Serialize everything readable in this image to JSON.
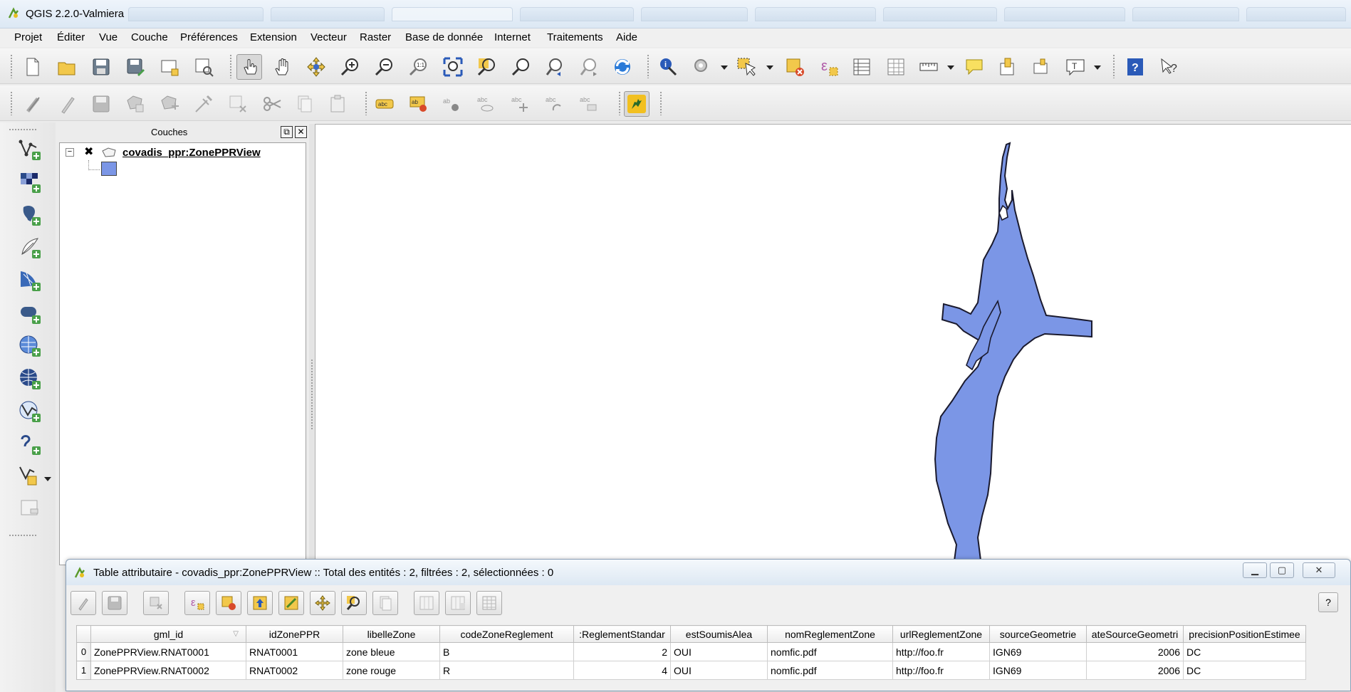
{
  "window": {
    "title": "QGIS 2.2.0-Valmiera"
  },
  "menu": [
    "Projet",
    "Éditer",
    "Vue",
    "Couche",
    "Préférences",
    "Extension",
    "Vecteur",
    "Raster",
    "Base de donnée",
    "Internet",
    "Traitements",
    "Aide"
  ],
  "toolbar_icons": {
    "file": [
      "new-project-icon",
      "open-project-icon",
      "save-project-icon",
      "save-as-icon",
      "new-print-composer-icon",
      "composer-manager-icon"
    ],
    "navigation": [
      "touch-zoom-icon",
      "pan-icon",
      "pan-to-selection-icon",
      "zoom-in-icon",
      "zoom-out-icon",
      "zoom-native-icon",
      "zoom-full-icon",
      "zoom-to-selection-icon",
      "zoom-to-layer-icon",
      "zoom-last-icon",
      "zoom-next-icon",
      "refresh-icon"
    ],
    "attributes": [
      "identify-icon",
      "action-icon",
      "select-icon",
      "deselect-icon",
      "expression-select-icon",
      "attribute-table-icon",
      "statistics-icon",
      "measure-icon",
      "map-tips-icon",
      "new-bookmark-icon",
      "show-bookmarks-icon",
      "text-annotation-icon",
      "help-icon",
      "whats-this-icon"
    ]
  },
  "layers_panel": {
    "title": "Couches",
    "layer": {
      "name": "covadis_ppr:ZonePPRView",
      "color": "#7b96e6"
    }
  },
  "attribute_table": {
    "title": "Table attributaire - covadis_ppr:ZonePPRView :: Total des entités : 2, filtrées : 2, sélectionnées : 0",
    "help_label": "?",
    "columns": [
      "gml_id",
      "idZonePPR",
      "libelleZone",
      "codeZoneReglement",
      ":ReglementStandar",
      "estSoumisAlea",
      "nomReglementZone",
      "urlReglementZone",
      "sourceGeometrie",
      "ateSourceGeometri",
      "precisionPositionEstimee"
    ],
    "rows": [
      {
        "num": "0",
        "cells": [
          "ZonePPRView.RNAT0001",
          "RNAT0001",
          "zone bleue",
          "B",
          "2",
          "OUI",
          "nomfic.pdf",
          "http://foo.fr",
          "IGN69",
          "2006",
          "DC"
        ]
      },
      {
        "num": "1",
        "cells": [
          "ZonePPRView.RNAT0002",
          "RNAT0002",
          "zone rouge",
          "R",
          "4",
          "OUI",
          "nomfic.pdf",
          "http://foo.fr",
          "IGN69",
          "2006",
          "DC"
        ]
      }
    ]
  },
  "colors": {
    "feature_fill": "#7b96e6",
    "feature_stroke": "#1a1a2e"
  }
}
